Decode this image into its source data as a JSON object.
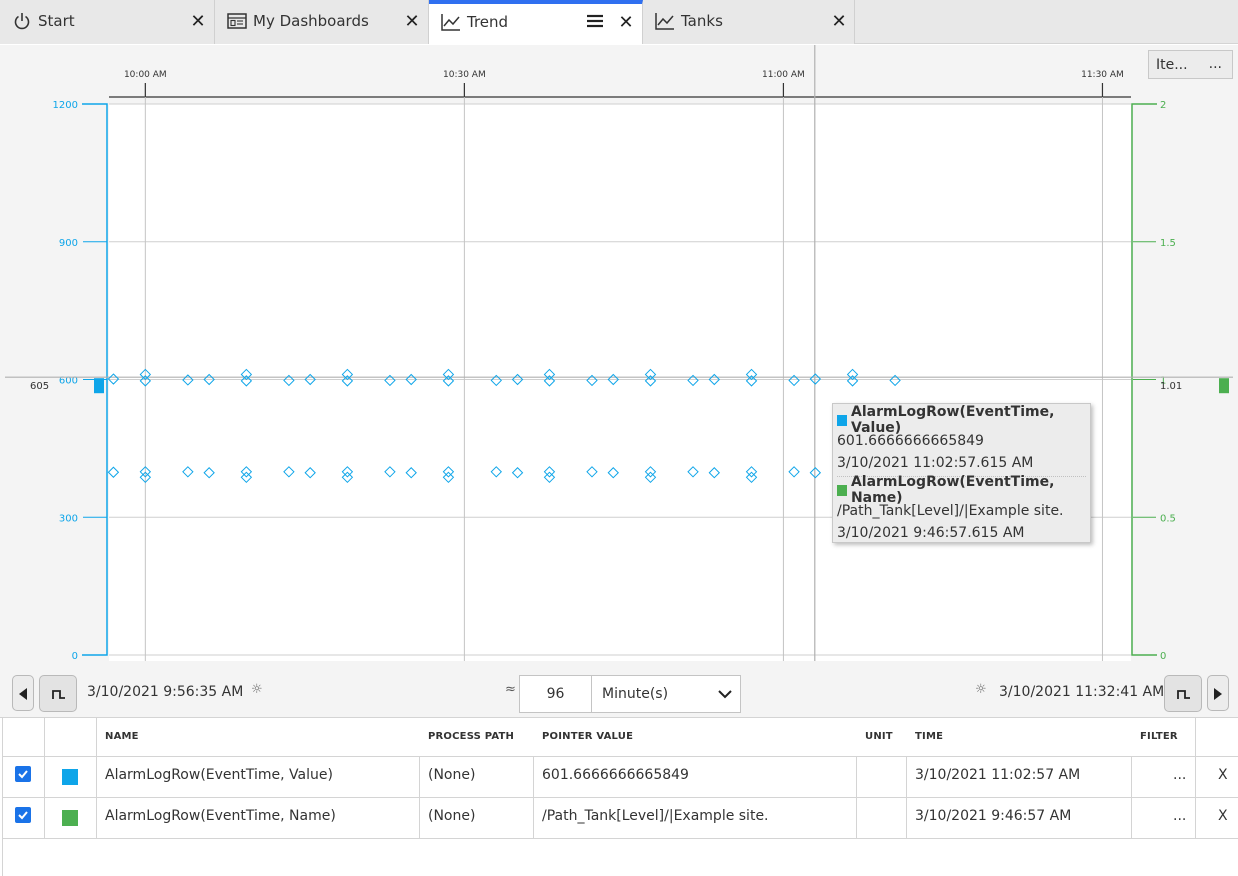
{
  "tabs": [
    {
      "label": "Start",
      "icon": "power-icon"
    },
    {
      "label": "My Dashboards",
      "icon": "dashboard-icon"
    },
    {
      "label": "Trend",
      "icon": "trend-icon"
    },
    {
      "label": "Tanks",
      "icon": "trend-icon"
    }
  ],
  "items_button": {
    "label": "Ite...",
    "more": "..."
  },
  "colors": {
    "series_value": "#0ea5e9",
    "series_name": "#4caf50",
    "accent": "#2f6ff0"
  },
  "chart_data": {
    "type": "scatter",
    "x_tick_labels": [
      "10:00 AM",
      "10:30 AM",
      "11:00 AM",
      "11:30 AM"
    ],
    "x_range": [
      "9:56:35 AM",
      "11:32:41 AM"
    ],
    "left_axis": {
      "ticks": [
        "1200",
        "900",
        "600",
        "300",
        "0"
      ],
      "ylim": [
        0,
        1200
      ],
      "cursor_label": "605"
    },
    "right_axis": {
      "ticks": [
        "2",
        "1.5",
        "1",
        "0.5",
        "0"
      ],
      "ylim": [
        0,
        2
      ],
      "cursor_label": "1.01"
    },
    "cursor_time": "11:02:57 AM",
    "series": [
      {
        "name": "AlarmLogRow(EventTime, Value)",
        "axis": "left",
        "points": [
          [
            "9:57:00",
            601
          ],
          [
            "9:57:00",
            398
          ],
          [
            "10:00:00",
            611
          ],
          [
            "10:00:00",
            597
          ],
          [
            "10:00:00",
            399
          ],
          [
            "10:00:00",
            387
          ],
          [
            "10:04:00",
            599
          ],
          [
            "10:04:00",
            399
          ],
          [
            "10:06:00",
            600
          ],
          [
            "10:06:00",
            397
          ],
          [
            "10:09:30",
            611
          ],
          [
            "10:09:30",
            597
          ],
          [
            "10:09:30",
            399
          ],
          [
            "10:09:30",
            387
          ],
          [
            "10:13:30",
            598
          ],
          [
            "10:13:30",
            399
          ],
          [
            "10:15:30",
            600
          ],
          [
            "10:15:30",
            397
          ],
          [
            "10:19:00",
            611
          ],
          [
            "10:19:00",
            597
          ],
          [
            "10:19:00",
            399
          ],
          [
            "10:19:00",
            387
          ],
          [
            "10:23:00",
            598
          ],
          [
            "10:23:00",
            399
          ],
          [
            "10:25:00",
            600
          ],
          [
            "10:25:00",
            397
          ],
          [
            "10:28:30",
            611
          ],
          [
            "10:28:30",
            597
          ],
          [
            "10:28:30",
            399
          ],
          [
            "10:28:30",
            387
          ],
          [
            "10:33:00",
            598
          ],
          [
            "10:33:00",
            399
          ],
          [
            "10:35:00",
            600
          ],
          [
            "10:35:00",
            397
          ],
          [
            "10:38:00",
            611
          ],
          [
            "10:38:00",
            597
          ],
          [
            "10:38:00",
            399
          ],
          [
            "10:38:00",
            387
          ],
          [
            "10:42:00",
            598
          ],
          [
            "10:42:00",
            399
          ],
          [
            "10:44:00",
            600
          ],
          [
            "10:44:00",
            397
          ],
          [
            "10:47:30",
            611
          ],
          [
            "10:47:30",
            597
          ],
          [
            "10:47:30",
            399
          ],
          [
            "10:47:30",
            387
          ],
          [
            "10:51:30",
            598
          ],
          [
            "10:51:30",
            399
          ],
          [
            "10:53:30",
            600
          ],
          [
            "10:53:30",
            397
          ],
          [
            "10:57:00",
            611
          ],
          [
            "10:57:00",
            597
          ],
          [
            "10:57:00",
            399
          ],
          [
            "10:57:00",
            387
          ],
          [
            "11:01:00",
            598
          ],
          [
            "11:01:00",
            399
          ],
          [
            "11:03:00",
            601
          ],
          [
            "11:03:00",
            397
          ],
          [
            "11:06:30",
            611
          ],
          [
            "11:06:30",
            597
          ],
          [
            "11:10:30",
            598
          ]
        ]
      },
      {
        "name": "AlarmLogRow(EventTime, Name)",
        "axis": "right",
        "points": []
      }
    ]
  },
  "tooltip": {
    "series1_name": "AlarmLogRow(EventTime, Value)",
    "series1_value": "601.6666666665849",
    "series1_time": "3/10/2021 11:02:57.615 AM",
    "series2_name": "AlarmLogRow(EventTime, Name)",
    "series2_value": "/Path_Tank[Level]/|Example site.",
    "series2_time": "3/10/2021 9:46:57.615 AM"
  },
  "timebar": {
    "start": "3/10/2021 9:56:35 AM",
    "end": "3/10/2021 11:32:41 AM",
    "approx": "≈",
    "span_value": "96",
    "span_unit": "Minute(s)"
  },
  "table": {
    "headers": {
      "name": "NAME",
      "process_path": "PROCESS PATH",
      "pointer_value": "POINTER VALUE",
      "unit": "UNIT",
      "time": "TIME",
      "filter": "FILTER"
    },
    "rows": [
      {
        "name": "AlarmLogRow(EventTime, Value)",
        "process_path": "(None)",
        "pointer_value": "601.6666666665849",
        "unit": "",
        "time": "3/10/2021 11:02:57 AM",
        "filter": "...",
        "remove": "X"
      },
      {
        "name": "AlarmLogRow(EventTime, Name)",
        "process_path": "(None)",
        "pointer_value": "/Path_Tank[Level]/|Example site.",
        "unit": "",
        "time": "3/10/2021 9:46:57 AM",
        "filter": "...",
        "remove": "X"
      }
    ]
  }
}
